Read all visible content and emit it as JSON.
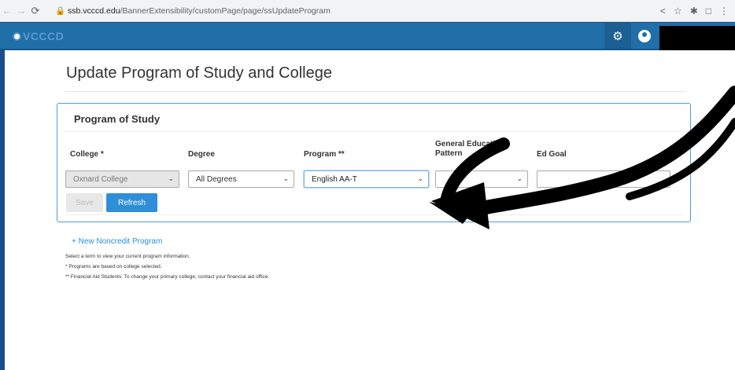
{
  "browser": {
    "back_icon": "arrow-left",
    "forward_icon": "arrow-right",
    "reload_icon": "reload",
    "url_host": "ssb.vcccd.edu",
    "url_path": "/BannerExtensibility/customPage/page/ssUpdateProgram",
    "toolbar_icons": [
      "share-icon",
      "star-icon",
      "puzzle-icon",
      "panel-icon",
      "more-icon"
    ]
  },
  "app": {
    "logo_text": "VCCCD",
    "brand_color": "#216fa8"
  },
  "page": {
    "title": "Update Program of Study and College"
  },
  "program_of_study": {
    "heading": "Program of Study",
    "columns": {
      "college": "College *",
      "degree": "Degree",
      "program": "Program **",
      "gen_ed_line1": "General Educatio",
      "gen_ed_line2": "Pattern",
      "ed_goal": "Ed Goal"
    },
    "values": {
      "college": "Oxnard College",
      "degree": "All Degrees",
      "program": "English AA-T",
      "gen_ed": "",
      "ed_goal": ""
    },
    "save_label": "Save",
    "refresh_label": "Refresh"
  },
  "links": {
    "new_noncredit": "+ New Noncredit Program"
  },
  "notes": [
    "Select a term to view your current program information.",
    "* Programs are based on college selected.",
    "** Financial Aid Students: To change your primary college, contact your financial aid office."
  ]
}
